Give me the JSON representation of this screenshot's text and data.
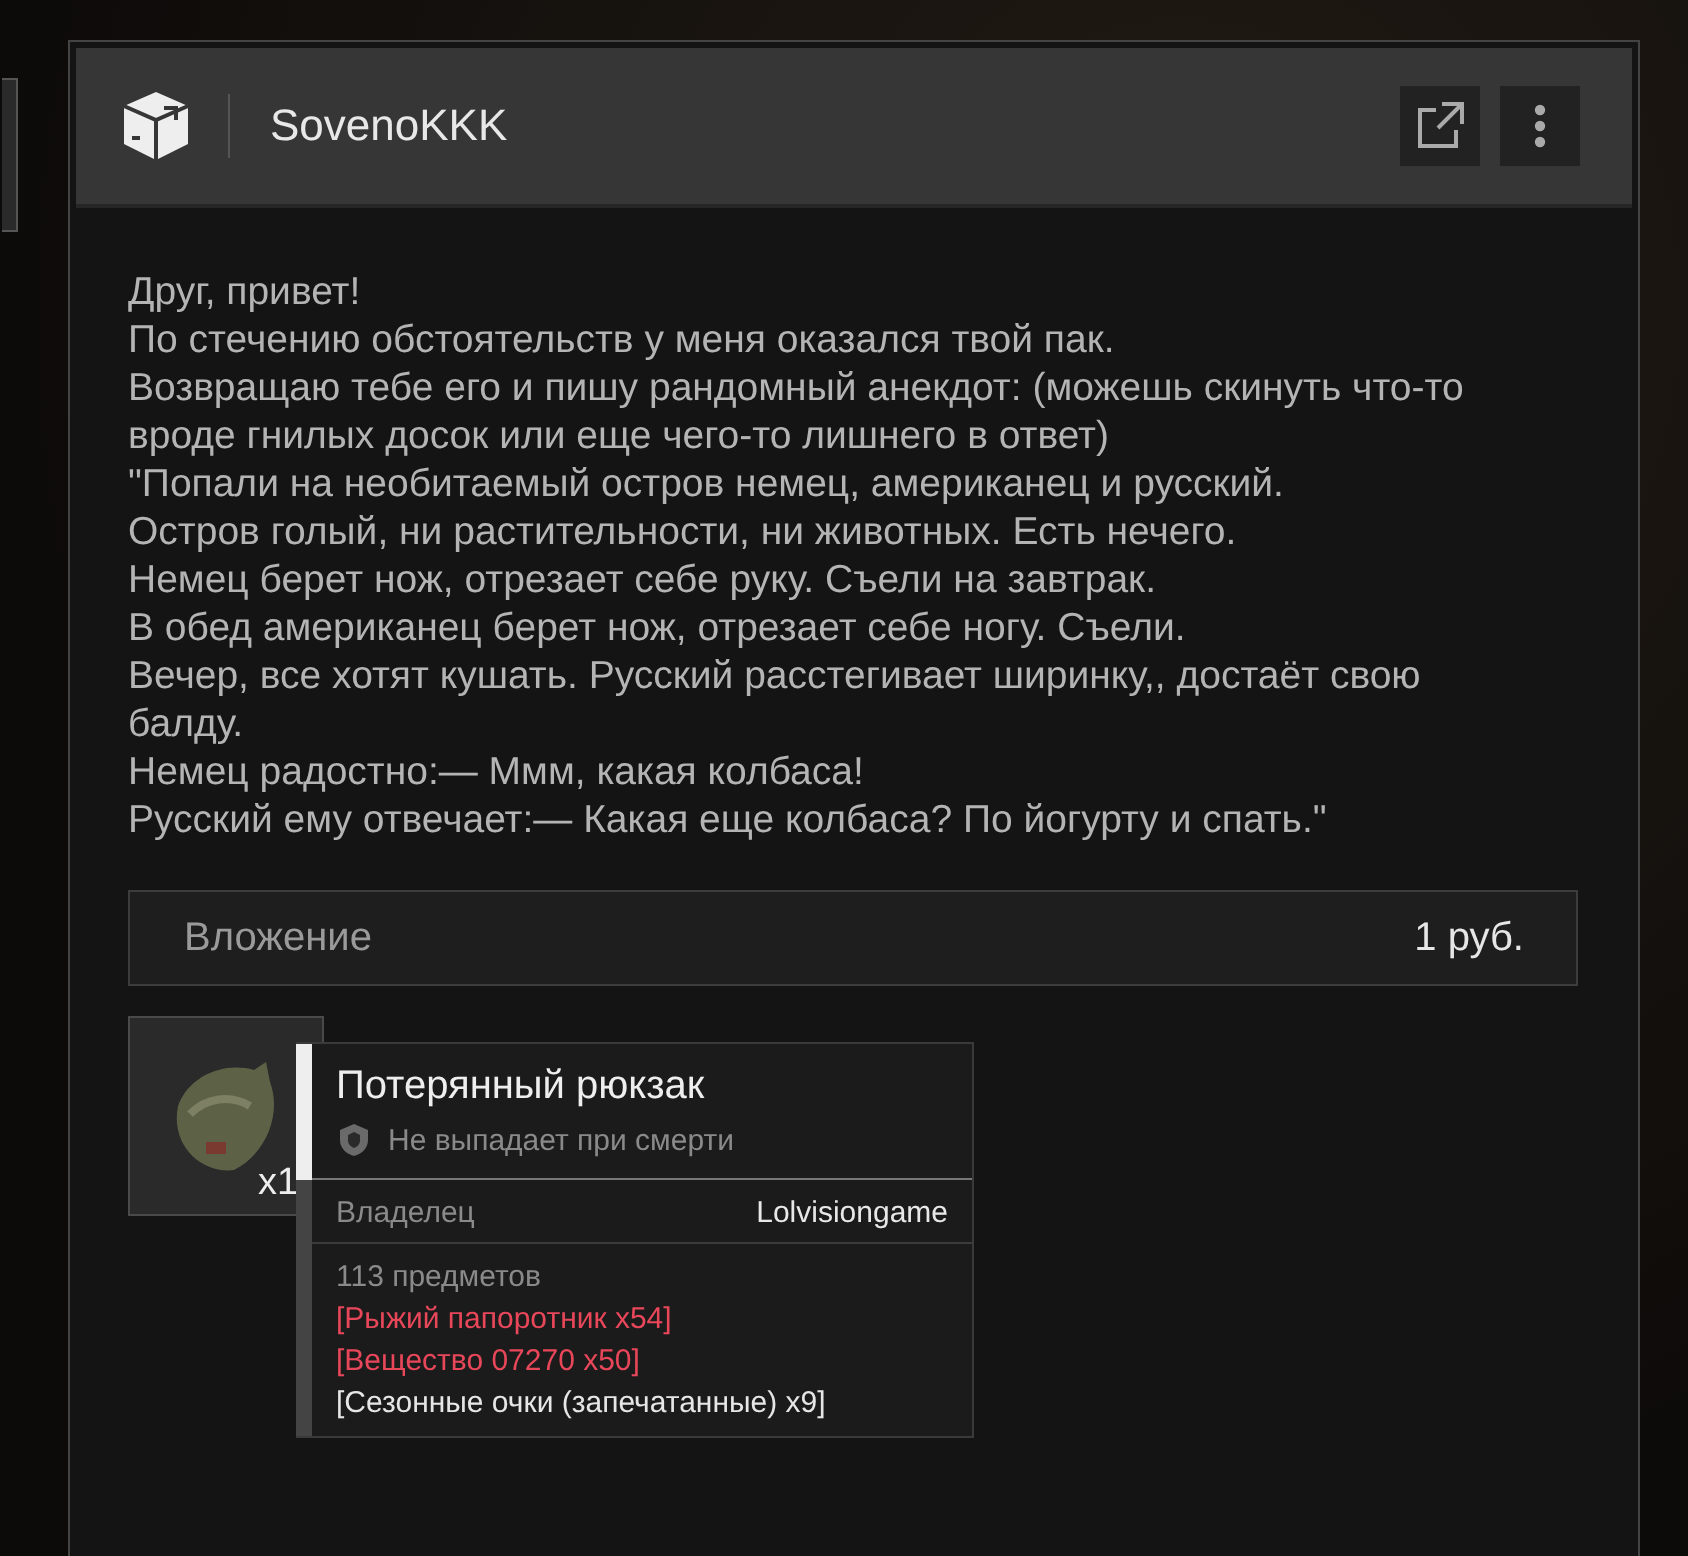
{
  "header": {
    "sender": "SovenoKKK"
  },
  "message": {
    "lines": [
      "Друг, привет!",
      "По стечению обстоятельств у меня оказался твой пак.",
      "Возвращаю тебе его и пишу рандомный анекдот: (можешь скинуть что-то вроде гнилых досок или еще чего-то лишнего в ответ)",
      "\"Попали на необитаемый остров немец, американец и русский.",
      "Остров голый, ни растительности, ни животных. Есть нечего.",
      "Немец берет нож, отрезает себе руку. Съели на завтрак.",
      "В обед американец берет нож, отрезает себе ногу. Съели.",
      "Вечер, все хотят кушать. Русский расстегивает ширинку,, достаёт свою балду.",
      "Немец радостно:— Ммм, какая колбаса!",
      "Русский ему отвечает:— Какая еще колбаса? По йогурту и спать.\""
    ]
  },
  "attachment": {
    "label": "Вложение",
    "amount": "1 руб."
  },
  "item": {
    "count": "x1",
    "tooltip": {
      "title": "Потерянный рюкзак",
      "note": "Не выпадает при смерти",
      "owner_label": "Владелец",
      "owner": "Lolvisiongame",
      "contents_count": "113 предметов",
      "contents": [
        {
          "text": "[Рыжий папоротник x54]",
          "color": "#e8475a"
        },
        {
          "text": "[Вещество 07270 x50]",
          "color": "#e8475a"
        },
        {
          "text": "[Сезонные очки (запечатанные) x9]",
          "color": "#e6e6e6"
        }
      ]
    }
  }
}
